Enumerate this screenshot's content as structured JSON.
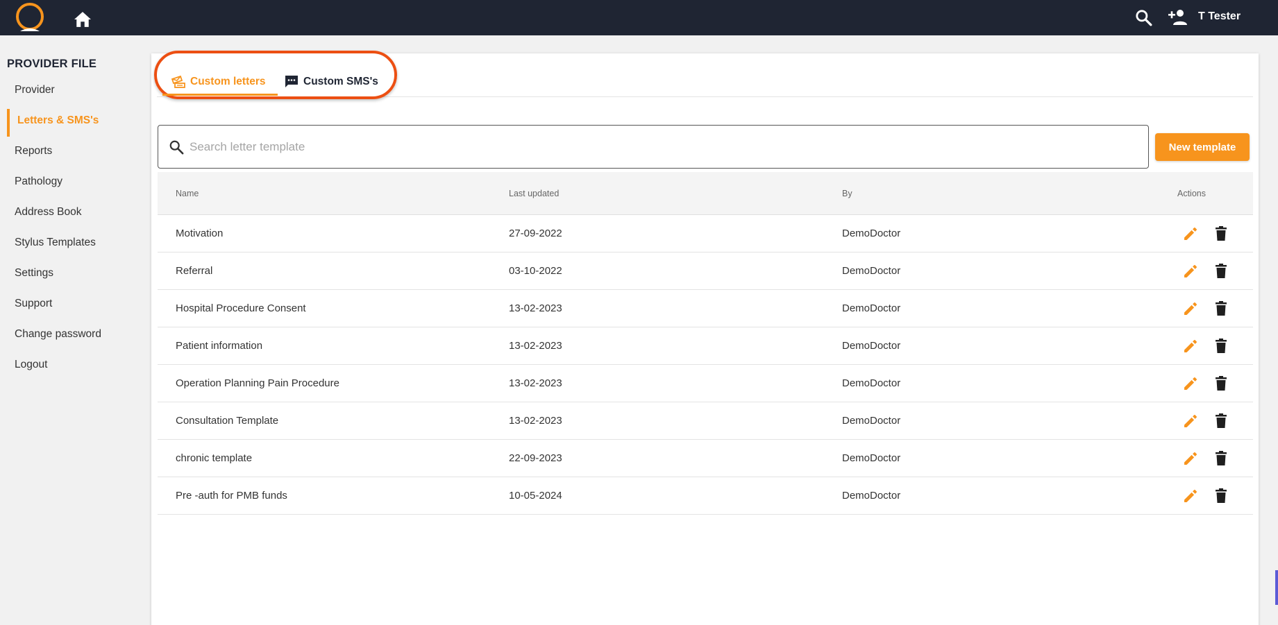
{
  "topbar": {
    "user_name": "T Tester",
    "icons": [
      "logo-icon",
      "home-icon",
      "search-icon",
      "add-user-icon"
    ]
  },
  "sidebar": {
    "title": "PROVIDER FILE",
    "items": [
      {
        "label": "Provider"
      },
      {
        "label": "Letters & SMS's",
        "active": true
      },
      {
        "label": "Reports"
      },
      {
        "label": "Pathology"
      },
      {
        "label": "Address Book"
      },
      {
        "label": "Stylus Templates"
      },
      {
        "label": "Settings"
      },
      {
        "label": "Support"
      },
      {
        "label": "Change password"
      },
      {
        "label": "Logout"
      }
    ]
  },
  "tabs": [
    {
      "label": "Custom letters",
      "icon": "letter-icon",
      "active": true
    },
    {
      "label": "Custom SMS's",
      "icon": "sms-icon",
      "active": false
    }
  ],
  "search": {
    "placeholder": "Search letter template",
    "value": ""
  },
  "new_template_label": "New template",
  "table": {
    "headers": {
      "name": "Name",
      "last_updated": "Last updated",
      "by": "By",
      "actions": "Actions"
    },
    "rows": [
      {
        "name": "Motivation",
        "last_updated": "27-09-2022",
        "by": "DemoDoctor"
      },
      {
        "name": "Referral",
        "last_updated": "03-10-2022",
        "by": "DemoDoctor"
      },
      {
        "name": "Hospital Procedure Consent",
        "last_updated": "13-02-2023",
        "by": "DemoDoctor"
      },
      {
        "name": "Patient information",
        "last_updated": "13-02-2023",
        "by": "DemoDoctor"
      },
      {
        "name": "Operation Planning Pain Procedure",
        "last_updated": "13-02-2023",
        "by": "DemoDoctor"
      },
      {
        "name": "Consultation Template",
        "last_updated": "13-02-2023",
        "by": "DemoDoctor"
      },
      {
        "name": "chronic template",
        "last_updated": "22-09-2023",
        "by": "DemoDoctor"
      },
      {
        "name": "Pre -auth for PMB funds",
        "last_updated": "10-05-2024",
        "by": "DemoDoctor"
      }
    ]
  },
  "colors": {
    "accent": "#f7941d",
    "topbar": "#1f2533",
    "highlight": "#ec4f12"
  }
}
